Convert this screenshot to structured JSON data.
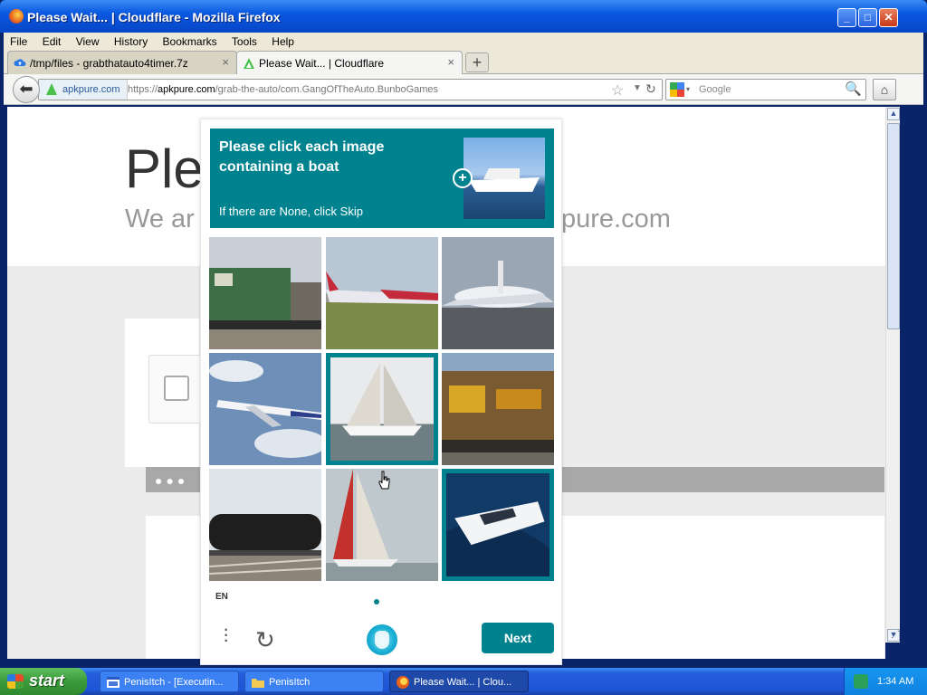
{
  "window": {
    "title": "Please Wait... | Cloudflare - Mozilla Firefox",
    "buttons": {
      "minimize": "_",
      "maximize": "□",
      "close": "✕"
    }
  },
  "menu": [
    "File",
    "Edit",
    "View",
    "History",
    "Bookmarks",
    "Tools",
    "Help"
  ],
  "tabs": [
    {
      "label": "/tmp/files - grabthatauto4timer.7z",
      "close": "×",
      "active": false
    },
    {
      "label": "Please Wait... | Cloudflare",
      "close": "×",
      "active": true
    }
  ],
  "new_tab": "+",
  "nav": {
    "site_badge": "apkpure.com",
    "url_prefix": "https://",
    "url_domain": "apkpure.com",
    "url_path": "/grab-the-auto/com.GangOfTheAuto.BunboGames",
    "search_placeholder": "Google"
  },
  "page": {
    "heading_partial": "Ple",
    "subheading_left": "We ar",
    "subheading_right": "pure.com",
    "progress_dots": "●●●"
  },
  "captcha": {
    "instruction": "Please click each image containing a boat",
    "hint": "If there are None, click Skip",
    "language": "EN",
    "next_label": "Next",
    "accent_color": "#00838f",
    "tiles": [
      {
        "name": "tile-train-green",
        "subject": "train",
        "selected": false
      },
      {
        "name": "tile-airplane-runway",
        "subject": "airplane",
        "selected": false
      },
      {
        "name": "tile-airplane-taxiing",
        "subject": "airplane",
        "selected": false
      },
      {
        "name": "tile-airplane-sky",
        "subject": "airplane",
        "selected": false
      },
      {
        "name": "tile-sailboat-white",
        "subject": "boat",
        "selected": true
      },
      {
        "name": "tile-train-graffiti",
        "subject": "train",
        "selected": false
      },
      {
        "name": "tile-train-tanker",
        "subject": "train",
        "selected": false
      },
      {
        "name": "tile-sailboat-red",
        "subject": "boat",
        "selected": false
      },
      {
        "name": "tile-speedboat",
        "subject": "boat",
        "selected": true
      }
    ]
  },
  "taskbar": {
    "start_label": "start",
    "items": [
      {
        "label": "PenisItch - [Executin...",
        "active": false
      },
      {
        "label": "PenisItch",
        "active": false
      },
      {
        "label": "Please Wait... | Clou...",
        "active": true
      }
    ],
    "clock": "1:34 AM"
  }
}
